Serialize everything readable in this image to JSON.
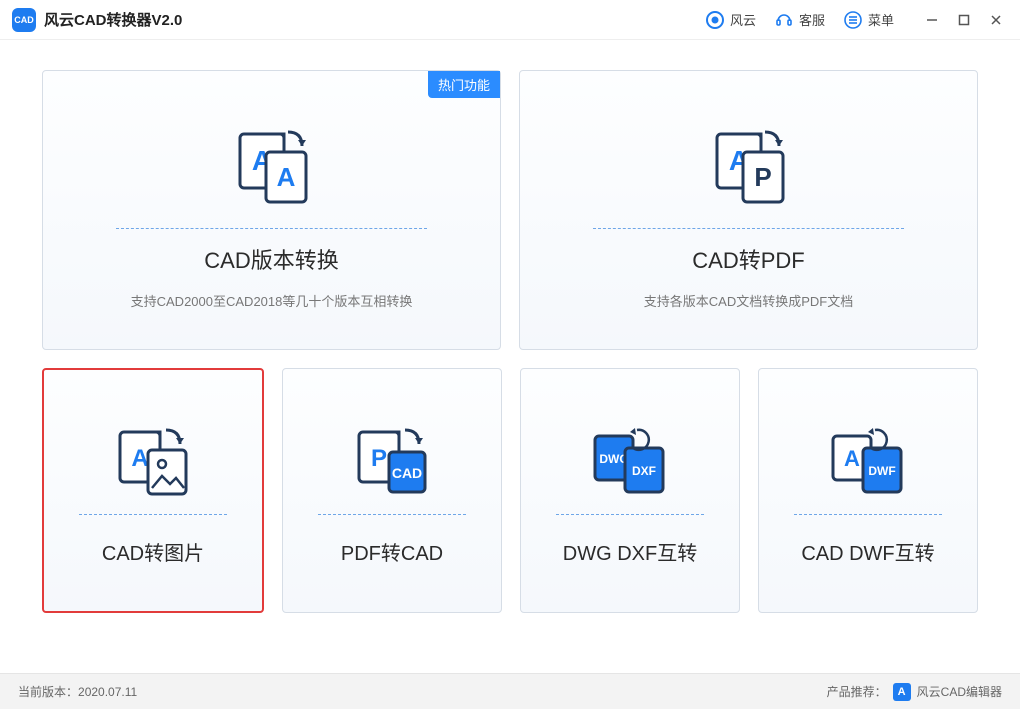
{
  "app": {
    "title": "风云CAD转换器V2.0"
  },
  "header": {
    "brand": "风云",
    "support": "客服",
    "menu": "菜单"
  },
  "cards": {
    "hot_badge": "热门功能",
    "cad_version": {
      "title": "CAD版本转换",
      "desc": "支持CAD2000至CAD2018等几十个版本互相转换"
    },
    "cad_to_pdf": {
      "title": "CAD转PDF",
      "desc": "支持各版本CAD文档转换成PDF文档"
    },
    "cad_to_img": {
      "title": "CAD转图片"
    },
    "pdf_to_cad": {
      "title": "PDF转CAD"
    },
    "dwg_dxf": {
      "title": "DWG DXF互转"
    },
    "cad_dwf": {
      "title": "CAD DWF互转"
    }
  },
  "footer": {
    "version_label": "当前版本：",
    "version_value": "2020.07.11",
    "recommend_label": "产品推荐：",
    "recommend_product": "风云CAD编辑器"
  },
  "colors": {
    "primary": "#1e7cf0",
    "accent": "#e23b3b"
  }
}
